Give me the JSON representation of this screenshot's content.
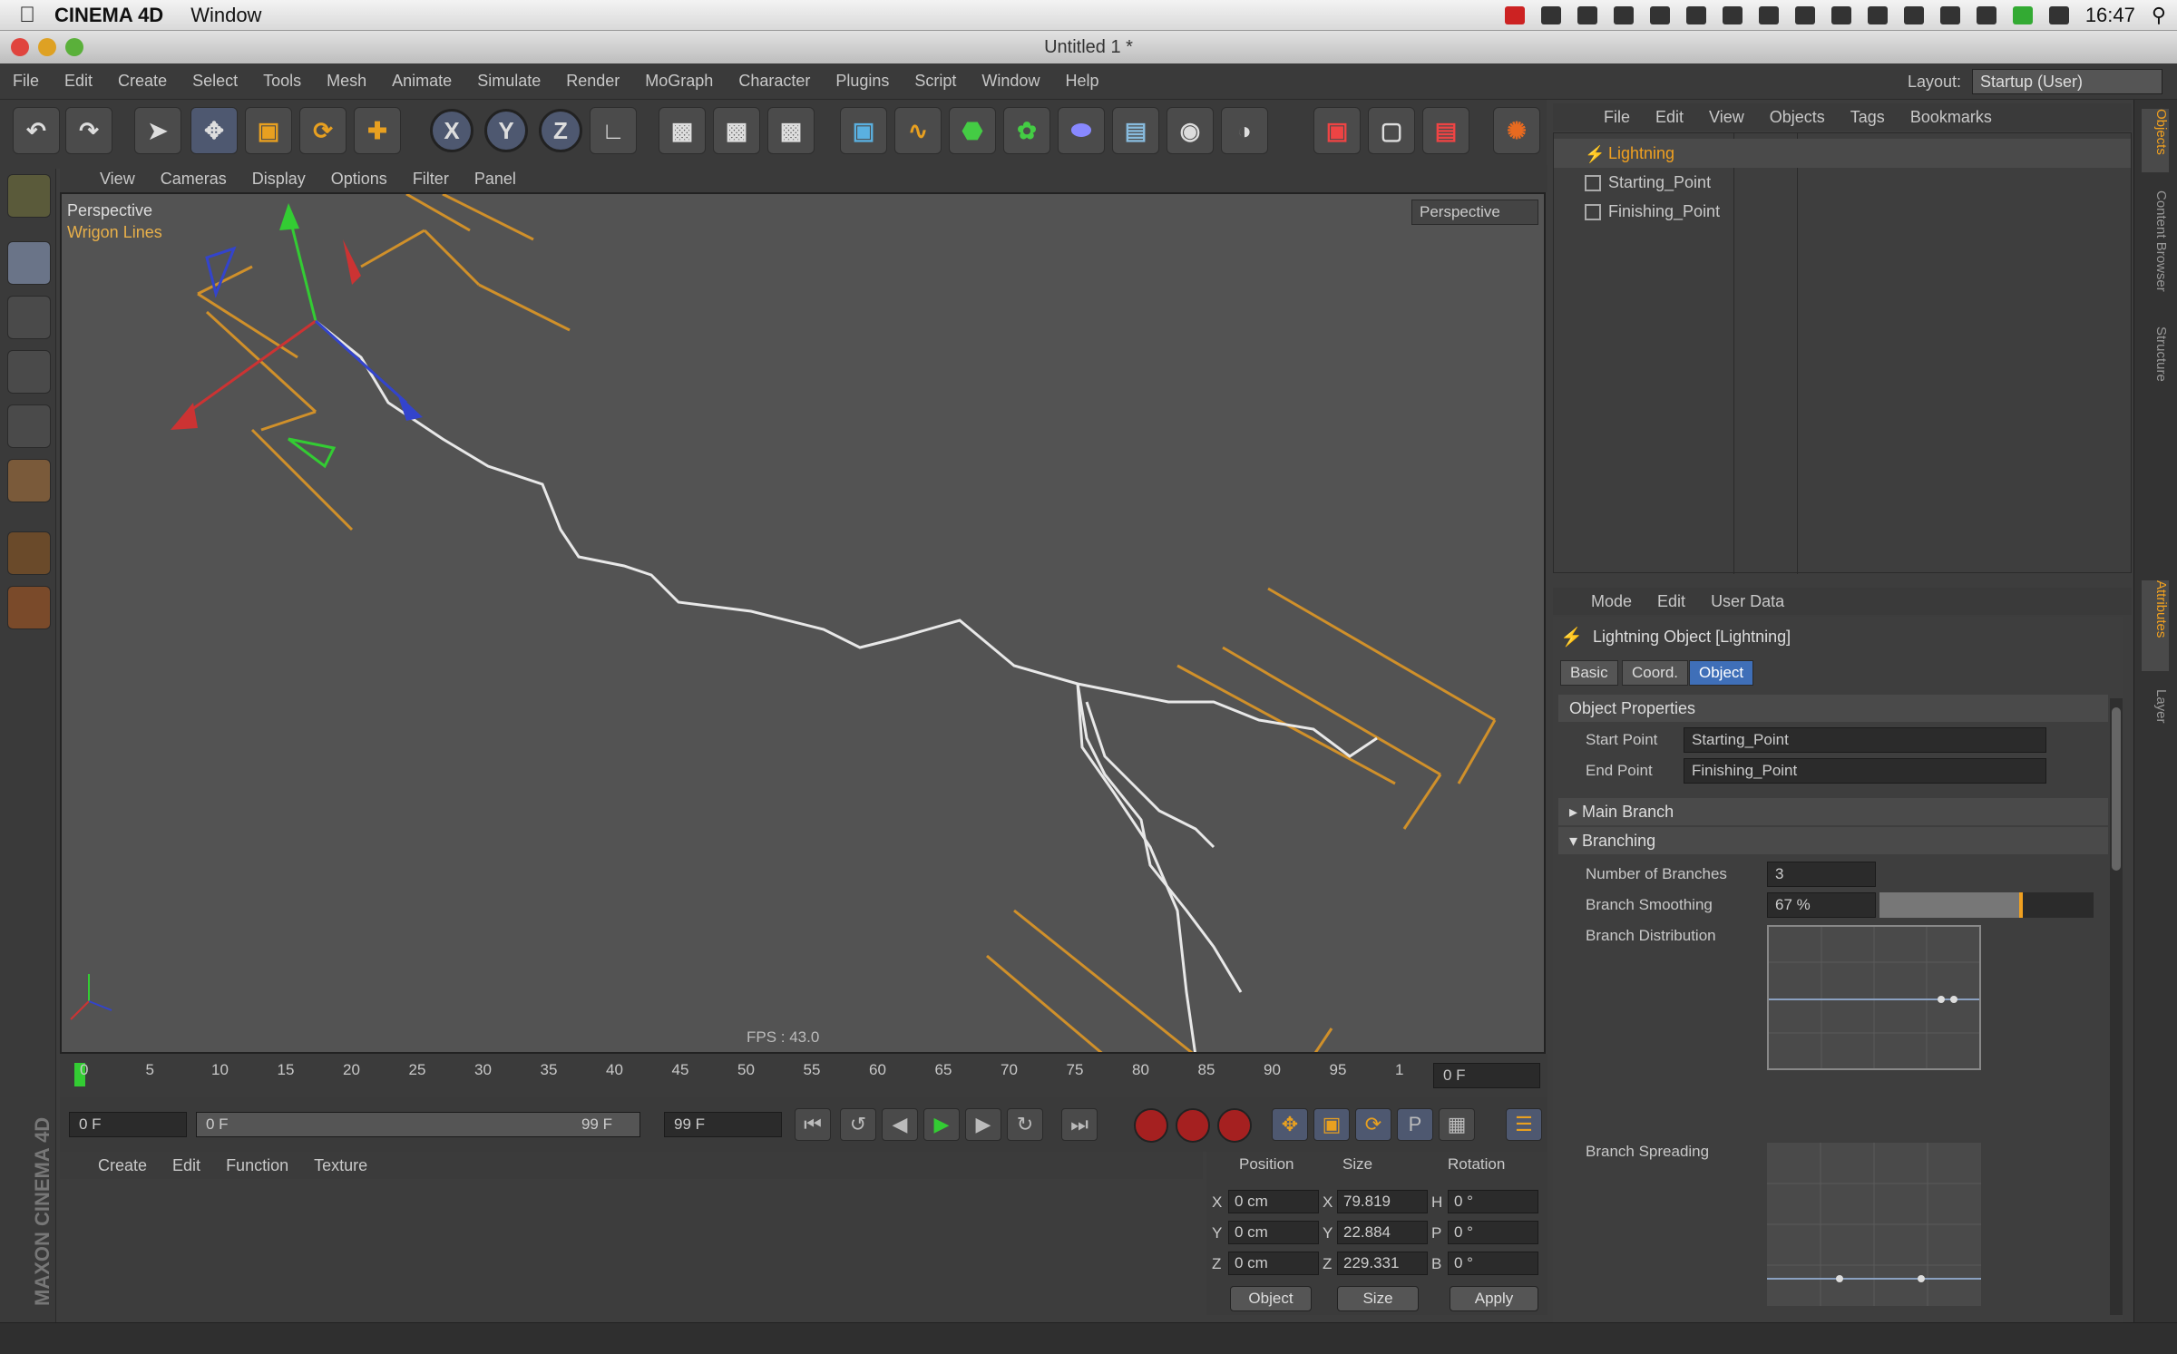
{
  "macbar": {
    "app_name": "CINEMA 4D",
    "menu": "Window",
    "clock": "16:47"
  },
  "window": {
    "title": "Untitled 1 *"
  },
  "menubar": {
    "items": [
      "File",
      "Edit",
      "Create",
      "Select",
      "Tools",
      "Mesh",
      "Animate",
      "Simulate",
      "Render",
      "MoGraph",
      "Character",
      "Plugins",
      "Script",
      "Window",
      "Help"
    ],
    "layout_label": "Layout:",
    "layout_value": "Startup (User)"
  },
  "toolbar": {
    "axis_x": "X",
    "axis_y": "Y",
    "axis_z": "Z"
  },
  "viewport": {
    "menu": [
      "View",
      "Cameras",
      "Display",
      "Options",
      "Filter",
      "Panel"
    ],
    "camera_label": "Perspective",
    "object_label": "Wrigon Lines",
    "perspective_button": "Perspective",
    "fps": "FPS : 43.0"
  },
  "timeline": {
    "ticks": [
      "0",
      "5",
      "10",
      "15",
      "20",
      "25",
      "30",
      "35",
      "40",
      "45",
      "50",
      "55",
      "60",
      "65",
      "70",
      "75",
      "80",
      "85",
      "90",
      "95",
      "1"
    ],
    "current_frame": "0 F"
  },
  "transport": {
    "start": "0 F",
    "range_start": "0 F",
    "range_end": "99 F",
    "end": "99 F"
  },
  "material_manager": {
    "menu": [
      "Create",
      "Edit",
      "Function",
      "Texture"
    ]
  },
  "coordinates": {
    "headers": [
      "Position",
      "Size",
      "Rotation"
    ],
    "rows": [
      {
        "axis": "X",
        "pos": "0 cm",
        "size_axis": "X",
        "size": "79.819",
        "rot_axis": "H",
        "rot": "0 °"
      },
      {
        "axis": "Y",
        "pos": "0 cm",
        "size_axis": "Y",
        "size": "22.884",
        "rot_axis": "P",
        "rot": "0 °"
      },
      {
        "axis": "Z",
        "pos": "0 cm",
        "size_axis": "Z",
        "size": "229.331",
        "rot_axis": "B",
        "rot": "0 °"
      }
    ],
    "mode_object": "Object",
    "mode_size": "Size",
    "apply": "Apply"
  },
  "brand": "MAXON CINEMA 4D",
  "object_manager": {
    "menu": [
      "File",
      "Edit",
      "View",
      "Objects",
      "Tags",
      "Bookmarks"
    ],
    "objects": [
      {
        "name": "Lightning",
        "selected": true
      },
      {
        "name": "Starting_Point",
        "selected": false
      },
      {
        "name": "Finishing_Point",
        "selected": false
      }
    ]
  },
  "attribute_manager": {
    "menu": [
      "Mode",
      "Edit",
      "User Data"
    ],
    "title": "Lightning Object [Lightning]",
    "tabs": [
      "Basic",
      "Coord.",
      "Object"
    ],
    "active_tab": "Object",
    "section_object_properties": "Object Properties",
    "start_point_label": "Start Point",
    "start_point_value": "Starting_Point",
    "end_point_label": "End Point",
    "end_point_value": "Finishing_Point",
    "section_main_branch": "Main Branch",
    "section_branching": "Branching",
    "num_branches_label": "Number of Branches",
    "num_branches_value": "3",
    "branch_smoothing_label": "Branch Smoothing",
    "branch_smoothing_value": "67 %",
    "branch_smoothing_fraction": 0.67,
    "branch_distribution_label": "Branch Distribution",
    "branch_spreading_label": "Branch Spreading"
  },
  "vtabs": [
    "Objects",
    "Content Browser",
    "Structure",
    "Attributes",
    "Layer"
  ],
  "colors": {
    "accent": "#f0a020",
    "selection_blue": "#3f6fb8",
    "viewport_bg": "#535353",
    "ui_bg": "#3a3a3a"
  }
}
